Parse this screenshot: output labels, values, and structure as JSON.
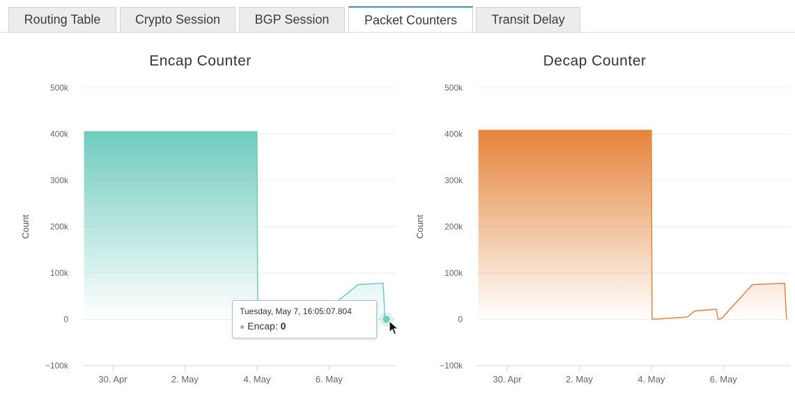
{
  "tabs": [
    {
      "label": "Routing Table",
      "active": false
    },
    {
      "label": "Crypto Session",
      "active": false
    },
    {
      "label": "BGP Session",
      "active": false
    },
    {
      "label": "Packet Counters",
      "active": true
    },
    {
      "label": "Transit Delay",
      "active": false
    }
  ],
  "tooltip": {
    "timestamp": "Tuesday, May 7, 16:05:07.804",
    "series": "Encap",
    "value": "0"
  },
  "chart_data": [
    {
      "type": "area",
      "title": "Encap Counter",
      "ylabel": "Count",
      "xlabel": "",
      "color": "#6fcbbd",
      "ylim": [
        -100000,
        500000
      ],
      "yticks": [
        500000,
        400000,
        300000,
        200000,
        100000,
        0,
        -100000
      ],
      "ytick_labels": [
        "500k",
        "400k",
        "300k",
        "200k",
        "100k",
        "0",
        "−100k"
      ],
      "xtick_labels": [
        "30. Apr",
        "2. May",
        "4. May",
        "6. May"
      ],
      "xtick_days": [
        30,
        32,
        34,
        36
      ],
      "xlim_days": [
        29.15,
        37.85
      ],
      "series": [
        {
          "values": [
            [
              29.2,
              405000
            ],
            [
              34.0,
              405000
            ],
            [
              34.02,
              0
            ],
            [
              35.6,
              2000
            ],
            [
              36.25,
              40000
            ],
            [
              36.8,
              75000
            ],
            [
              37.5,
              78000
            ],
            [
              37.55,
              0
            ]
          ]
        }
      ],
      "grid": true
    },
    {
      "type": "area",
      "title": "Decap Counter",
      "ylabel": "Count",
      "xlabel": "",
      "color": "#e5843b",
      "ylim": [
        -100000,
        500000
      ],
      "yticks": [
        500000,
        400000,
        300000,
        200000,
        100000,
        0,
        -100000
      ],
      "ytick_labels": [
        "500k",
        "400k",
        "300k",
        "200k",
        "100k",
        "0",
        "−100k"
      ],
      "xtick_labels": [
        "30. Apr",
        "2. May",
        "4. May",
        "6. May"
      ],
      "xtick_days": [
        30,
        32,
        34,
        36
      ],
      "xlim_days": [
        29.15,
        37.85
      ],
      "series": [
        {
          "values": [
            [
              29.2,
              408000
            ],
            [
              34.0,
              408000
            ],
            [
              34.02,
              0
            ],
            [
              35.0,
              5000
            ],
            [
              35.2,
              18000
            ],
            [
              35.8,
              22000
            ],
            [
              35.85,
              0
            ],
            [
              35.95,
              2000
            ],
            [
              36.8,
              75000
            ],
            [
              37.7,
              78000
            ],
            [
              37.75,
              0
            ]
          ]
        }
      ],
      "grid": true
    }
  ]
}
